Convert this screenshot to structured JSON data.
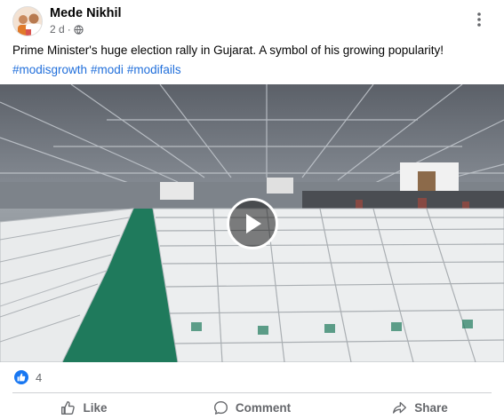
{
  "post": {
    "author": "Mede Nikhil",
    "time": "2 d",
    "separator": "·",
    "caption": "Prime Minister's huge election rally in Gujarat. A symbol of his growing popularity!",
    "hashtags": [
      "#modisgrowth",
      "#modi",
      "#modifails"
    ]
  },
  "reactions": {
    "count": "4",
    "icon": "like-icon"
  },
  "actions": {
    "like": "Like",
    "comment": "Comment",
    "share": "Share"
  },
  "colors": {
    "link": "#216fdb",
    "like_blue": "#1877f2",
    "muted": "#65676b",
    "field_green": "#1f7a5c"
  }
}
